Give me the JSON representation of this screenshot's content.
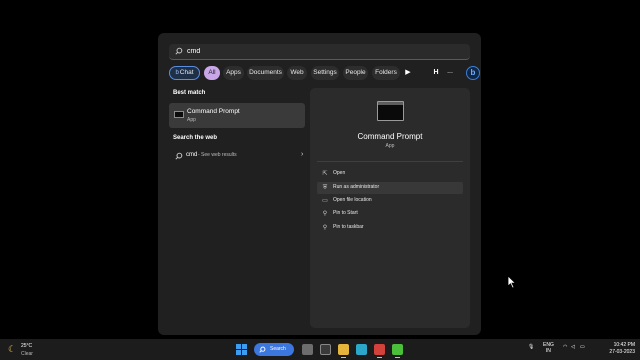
{
  "search": {
    "query": "cmd"
  },
  "filters": [
    "Chat",
    "All",
    "Apps",
    "Documents",
    "Web",
    "Settings",
    "People",
    "Folders"
  ],
  "filter_active": "All",
  "filter_more": {
    "h": "H",
    "more": "..."
  },
  "best_match": {
    "heading": "Best match",
    "name": "Command Prompt",
    "kind": "App"
  },
  "web": {
    "heading": "Search the web",
    "query": "cmd",
    "sub": "- See web results"
  },
  "details": {
    "name": "Command Prompt",
    "kind": "App",
    "actions": [
      "Open",
      "Run as administrator",
      "Open file location",
      "Pin to Start",
      "Pin to taskbar"
    ]
  },
  "taskbar": {
    "weather_temp": "25°C",
    "weather_cond": "Clear",
    "search_label": "Search",
    "lang_line1": "ENG",
    "lang_line2": "IN",
    "time": "10:42 PM",
    "date": "27-03-2023"
  },
  "colors": {
    "accent": "#3c77e0",
    "active_pill": "#c8a7e8",
    "chat_ring": "#5b8ede"
  },
  "icons": [
    "search-icon",
    "play-icon",
    "bing-icon",
    "open-icon",
    "shield-icon",
    "folder-icon",
    "pin-icon",
    "moon-icon",
    "windows-icon",
    "wifi-icon",
    "speaker-icon",
    "battery-icon",
    "mic-icon"
  ]
}
